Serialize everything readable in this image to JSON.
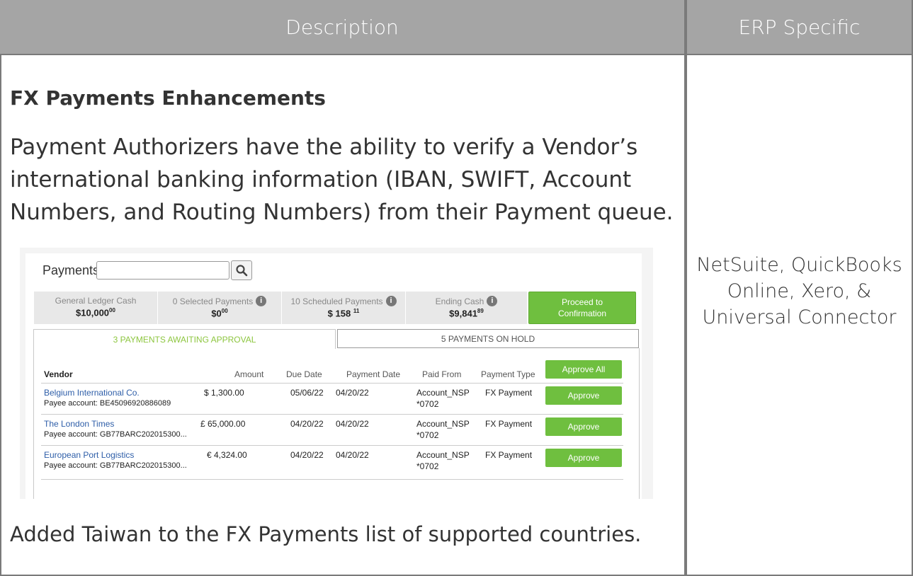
{
  "header": {
    "description": "Description",
    "erp_specific": "ERP Specific"
  },
  "section": {
    "title": "FX Payments Enhancements",
    "paragraph": "Payment Authorizers have the ability to verify a Vendor’s international banking information (IBAN, SWIFT, Account Numbers, and Routing Numbers) from their Payment queue.",
    "paragraph2": "Added Taiwan to the FX Payments list of supported countries."
  },
  "erp": {
    "text": "NetSuite, QuickBooks Online, Xero, & Universal Connector"
  },
  "screenshot": {
    "payments_label": "Payments",
    "search_value": "",
    "summary": [
      {
        "label": "General Ledger Cash",
        "value": "$10,000",
        "cents": "00",
        "info": false
      },
      {
        "label": "0 Selected Payments",
        "value": "$0",
        "cents": "00",
        "info": true
      },
      {
        "label": "10 Scheduled Payments",
        "value": "$ 158",
        "cents": "11",
        "info": true
      },
      {
        "label": "Ending Cash",
        "value": "$9,841",
        "cents": "89",
        "info": true
      }
    ],
    "proceed_label": "Proceed to Confirmation",
    "tabs": [
      {
        "label": "3 PAYMENTS AWAITING APPROVAL",
        "active": true
      },
      {
        "label": "5 PAYMENTS ON HOLD",
        "active": false
      }
    ],
    "columns": [
      "Vendor",
      "Amount",
      "Due Date",
      "Payment Date",
      "Paid From",
      "Payment Type"
    ],
    "approve_all_label": "Approve All",
    "approve_label": "Approve",
    "rows": [
      {
        "vendor": "Belgium International Co.",
        "payee": "Payee account: BE45096920886089",
        "amount": "$ 1,300.00",
        "due": "05/06/22",
        "pay_date": "04/20/22",
        "paid_from": "Account_NSP",
        "paid_from2": "*0702",
        "type": "FX Payment"
      },
      {
        "vendor": "The London Times",
        "payee": "Payee account: GB77BARC202015300...",
        "amount": "£ 65,000.00",
        "due": "04/20/22",
        "pay_date": "04/20/22",
        "paid_from": "Account_NSP",
        "paid_from2": "*0702",
        "type": "FX Payment"
      },
      {
        "vendor": "European Port Logistics",
        "payee": "Payee account: GB77BARC202015300...",
        "amount": "€ 4,324.00",
        "due": "04/20/22",
        "pay_date": "04/20/22",
        "paid_from": "Account_NSP",
        "paid_from2": "*0702",
        "type": "FX Payment"
      }
    ]
  },
  "colors": {
    "header_bg": "#a5a5a5",
    "border": "#7a7a7a",
    "green": "#6fbf3f",
    "link_blue": "#2e5ea8",
    "tab_green": "#8dc63f"
  }
}
